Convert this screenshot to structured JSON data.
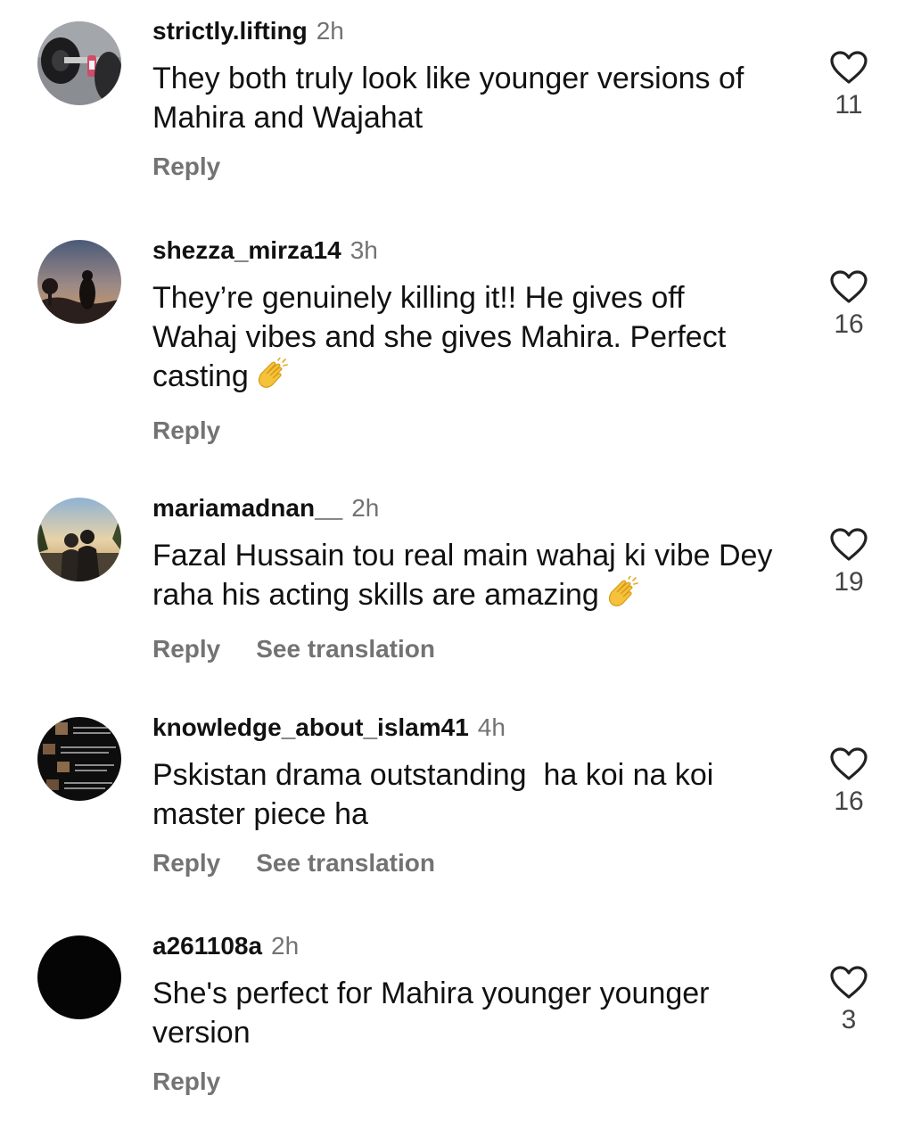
{
  "comments": [
    {
      "username": "strictly.lifting",
      "time": "2h",
      "text": "They both truly look like younger versions of Mahira and Wajahat",
      "reply_label": "Reply",
      "likes": "11",
      "avatar_icon": "barbell-photo"
    },
    {
      "username": "shezza_mirza14",
      "time": "3h",
      "text": "They’re genuinely killing it!! He gives off Wahaj vibes and she gives Mahira. Perfect casting",
      "emoji": "clapping-hands-icon",
      "reply_label": "Reply",
      "likes": "16",
      "avatar_icon": "sunset-silhouette-photo"
    },
    {
      "username": "mariamadnan__",
      "time": "2h",
      "text": "Fazal Hussain tou real main wahaj ki vibe Dey raha his acting skills are amazing",
      "emoji": "clapping-hands-icon",
      "reply_label": "Reply",
      "translate_label": "See translation",
      "likes": "19",
      "avatar_icon": "couple-sunset-photo"
    },
    {
      "username": "knowledge_about_islam41",
      "time": "4h",
      "text": "Pskistan drama outstanding  ha koi na koi master piece ha",
      "reply_label": "Reply",
      "translate_label": "See translation",
      "likes": "16",
      "avatar_icon": "arabic-text-collage-photo"
    },
    {
      "username": "a261108a",
      "time": "2h",
      "text": "She's perfect for Mahira younger younger version",
      "reply_label": "Reply",
      "likes": "3",
      "avatar_icon": "black-avatar"
    }
  ],
  "colors": {
    "text": "#111111",
    "secondary": "#737373",
    "like_count": "#444444",
    "heart_outline": "#222222"
  }
}
